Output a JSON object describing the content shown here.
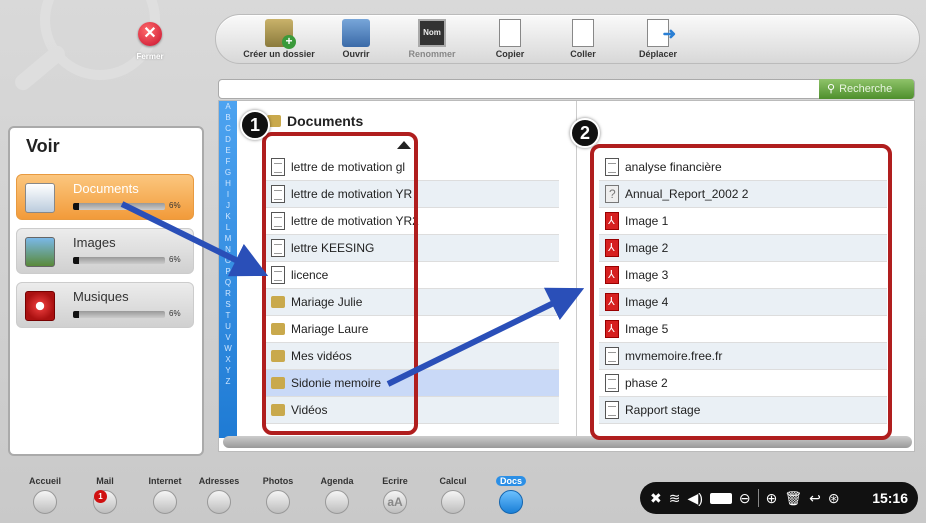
{
  "close": {
    "label": "Fermer"
  },
  "toolbar": {
    "create_folder": "Créer un dossier",
    "open": "Ouvrir",
    "rename": "Renommer",
    "rename_icon_text": "Nom",
    "copy": "Copier",
    "paste": "Coller",
    "move": "Déplacer"
  },
  "search": {
    "label": "Recherche",
    "placeholder": ""
  },
  "voir": {
    "title": "Voir",
    "categories": [
      {
        "label": "Documents",
        "percent": "6%",
        "usage": 0.06,
        "active": true
      },
      {
        "label": "Images",
        "percent": "6%",
        "usage": 0.06,
        "active": false
      },
      {
        "label": "Musiques",
        "percent": "6%",
        "usage": 0.06,
        "active": false
      }
    ]
  },
  "alphabet": [
    "A",
    "B",
    "C",
    "D",
    "E",
    "F",
    "G",
    "H",
    "I",
    "J",
    "K",
    "L",
    "M",
    "N",
    "O",
    "P",
    "Q",
    "R",
    "S",
    "T",
    "U",
    "V",
    "W",
    "X",
    "Y",
    "Z"
  ],
  "folder": {
    "title": "Documents",
    "items": [
      {
        "name": "lettre de motivation gl",
        "type": "doc"
      },
      {
        "name": "lettre de motivation YR",
        "type": "doc"
      },
      {
        "name": "lettre de motivation YR2",
        "type": "doc"
      },
      {
        "name": "lettre KEESING",
        "type": "doc"
      },
      {
        "name": "licence",
        "type": "doc"
      },
      {
        "name": "Mariage Julie",
        "type": "folder"
      },
      {
        "name": "Mariage Laure",
        "type": "folder"
      },
      {
        "name": "Mes vidéos",
        "type": "folder"
      },
      {
        "name": "Sidonie memoire",
        "type": "folder",
        "selected": true
      },
      {
        "name": "Vidéos",
        "type": "folder"
      }
    ]
  },
  "subfolder": {
    "items": [
      {
        "name": "analyse financière",
        "type": "doc"
      },
      {
        "name": "Annual_Report_2002 2",
        "type": "unknown"
      },
      {
        "name": "Image 1",
        "type": "pdf"
      },
      {
        "name": "Image 2",
        "type": "pdf"
      },
      {
        "name": "Image 3",
        "type": "pdf"
      },
      {
        "name": "Image 4",
        "type": "pdf"
      },
      {
        "name": "Image 5",
        "type": "pdf"
      },
      {
        "name": "mvmemoire.free.fr",
        "type": "doc"
      },
      {
        "name": "phase 2",
        "type": "doc"
      },
      {
        "name": "Rapport stage",
        "type": "doc"
      }
    ]
  },
  "annotations": {
    "badge1": "1",
    "badge2": "2",
    "highlight_color": "#b01e1e",
    "arrow_color": "#2a4fb8"
  },
  "dock": [
    {
      "label": "Accueil",
      "icon": "home-icon"
    },
    {
      "label": "Mail",
      "icon": "mail-icon",
      "badge": "1"
    },
    {
      "label": "Internet",
      "icon": "globe-icon"
    },
    {
      "label": "Adresses",
      "icon": "contacts-icon"
    },
    {
      "label": "Photos",
      "icon": "camera-icon"
    },
    {
      "label": "Agenda",
      "icon": "agenda-icon"
    },
    {
      "label": "Ecrire",
      "icon": "write-icon",
      "icon_text": "aA"
    },
    {
      "label": "Calcul",
      "icon": "calculator-icon"
    },
    {
      "label": "Docs",
      "icon": "docs-icon",
      "active": true
    }
  ],
  "tray": {
    "clock": "15:16"
  }
}
